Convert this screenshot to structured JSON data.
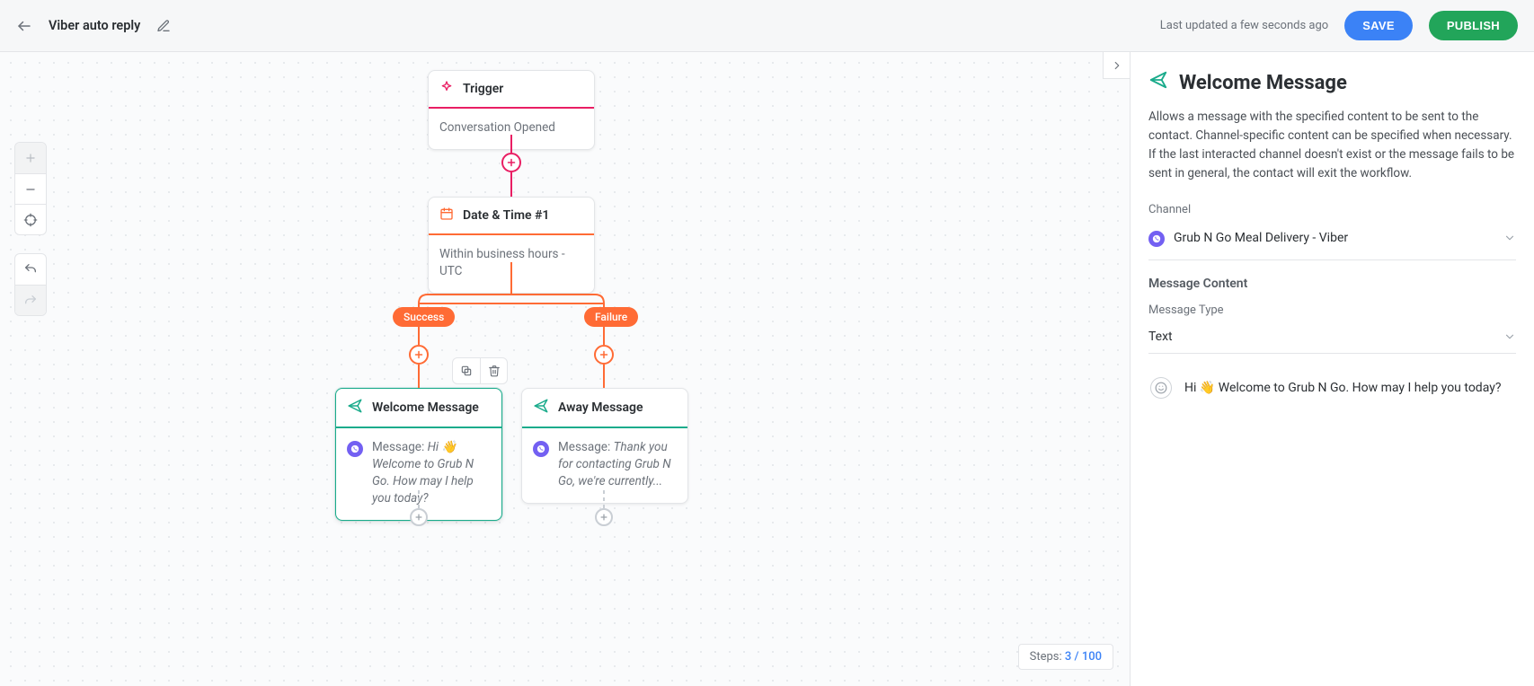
{
  "header": {
    "title": "Viber auto reply",
    "updated_text": "Last updated a few seconds ago",
    "save_label": "SAVE",
    "publish_label": "PUBLISH"
  },
  "canvas": {
    "steps_label": "Steps:",
    "steps_value": "3 / 100"
  },
  "flow": {
    "trigger": {
      "title": "Trigger",
      "body": "Conversation Opened"
    },
    "datetime": {
      "title": "Date & Time #1",
      "body": "Within business hours - UTC"
    },
    "branches": {
      "success": "Success",
      "failure": "Failure"
    },
    "welcome": {
      "title": "Welcome Message",
      "message_label": "Message:",
      "message": "Hi 👋 Welcome to Grub N Go. How may I help you today?"
    },
    "away": {
      "title": "Away Message",
      "message_label": "Message:",
      "message": "Thank you for contacting Grub N Go, we're currently..."
    }
  },
  "panel": {
    "title": "Welcome Message",
    "description": "Allows a message with the specified content to be sent to the contact. Channel-specific content can be specified when necessary. If the last interacted channel doesn't exist or the message fails to be sent in general, the contact will exit the workflow.",
    "channel_label": "Channel",
    "channel_value": "Grub N Go Meal Delivery - Viber",
    "content_section": "Message Content",
    "type_label": "Message Type",
    "type_value": "Text",
    "message_value": "Hi 👋 Welcome to Grub N Go. How may I help you today?"
  }
}
